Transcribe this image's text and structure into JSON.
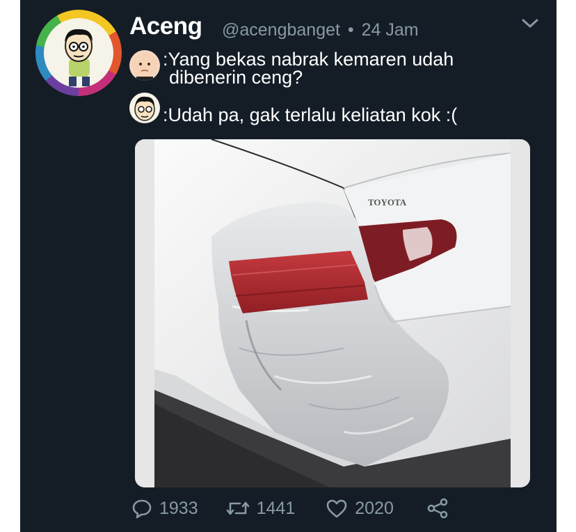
{
  "tweet": {
    "display_name": "Aceng",
    "handle": "@acengbanget",
    "separator": "•",
    "time": "24 Jam",
    "lines": [
      {
        "speaker_icon": "boss-baby-avatar-icon",
        "text_line1": ":Yang bekas nabrak kemaren udah",
        "text_line2": "dibenerin ceng?"
      },
      {
        "speaker_icon": "cartoon-boy-avatar-icon",
        "text_line1": ":Udah pa, gak terlalu keliatan kok :("
      }
    ],
    "photo": {
      "badge": "TOYOTA"
    }
  },
  "actions": {
    "replies": "1933",
    "retweets": "1441",
    "likes": "2020"
  },
  "colors": {
    "background": "#141d26",
    "text": "#ffffff",
    "muted": "#8899a6"
  }
}
